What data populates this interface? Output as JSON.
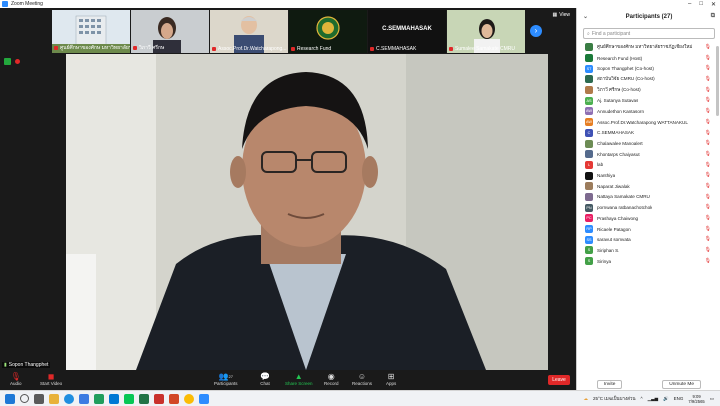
{
  "window": {
    "title": "Zoom Meeting"
  },
  "strip": {
    "view_label": "View",
    "thumbs": [
      {
        "name": "ศูนย์ศึกษาของศักษ มหาวิทยาลัยราช..."
      },
      {
        "name": "วิภาวี ศรีกษ"
      },
      {
        "name": "Assoc.Prof.Dr.Watcharapong..."
      },
      {
        "name": "Research Fund"
      },
      {
        "name": "C.SEMMAHASAK",
        "center_text": "C.SEMMAHASAK"
      },
      {
        "name": "Sumalee Samakate CMRU"
      }
    ]
  },
  "speaker": {
    "name": "Sopon Thangphet"
  },
  "toolbar": {
    "audio": "Audio",
    "video": "Start Video",
    "participants": "Participants",
    "participants_count": "27",
    "chat": "Chat",
    "share": "Share Screen",
    "record": "Record",
    "reactions": "Reactions",
    "apps": "Apps",
    "end": "Leave"
  },
  "panel": {
    "title": "Participants (27)",
    "search_placeholder": "Find a participant",
    "invite": "Invite",
    "unmute_me": "Unmute Me",
    "participants": [
      {
        "initials": "",
        "color": "#3a7d44",
        "name": "ศูนย์ศึกษาของศักษ มหาวิทยาลัยราชภัฏเชียงใหม่ (Me)"
      },
      {
        "initials": "",
        "color": "#1b7a3a",
        "name": "Research Fund (Host)"
      },
      {
        "initials": "ST",
        "color": "#2d8cff",
        "name": "Sopon Thangphet (Co-host)"
      },
      {
        "initials": "",
        "color": "#2d6a4f",
        "name": "สถาบันวิจัย CMRU (Co-host)"
      },
      {
        "initials": "",
        "color": "#b07a4a",
        "name": "วิภาวี ศรีกษ (Co-host)"
      },
      {
        "initials": "AS",
        "color": "#4caf50",
        "name": "Aj. Sutanya Sutavas"
      },
      {
        "initials": "AW",
        "color": "#8e6fb3",
        "name": "Annudethon Kantasorn"
      },
      {
        "initials": "AW",
        "color": "#e67e22",
        "name": "Assoc.Prof.Dr.Watcharapong WATTANAKUL"
      },
      {
        "initials": "C",
        "color": "#3f51b5",
        "name": "C.SEMMAHASAK"
      },
      {
        "initials": "",
        "color": "#6d8c55",
        "name": "Chalawalee Manoalert"
      },
      {
        "initials": "",
        "color": "#556b8d",
        "name": "Khontarps Chaiyasut"
      },
      {
        "initials": "L",
        "color": "#e53935",
        "name": "lab"
      },
      {
        "initials": "",
        "color": "#111111",
        "name": "Nanthiya"
      },
      {
        "initials": "",
        "color": "#9c7c5c",
        "name": "Naparat Jiwalak"
      },
      {
        "initials": "",
        "color": "#7d6a8f",
        "name": "Nattaya Samakate CMRU"
      },
      {
        "initials": "PN",
        "color": "#455a64",
        "name": "pornwana ratbanachotchok"
      },
      {
        "initials": "PC",
        "color": "#e91e63",
        "name": "Prashaya Chaiwong"
      },
      {
        "initials": "RP",
        "color": "#2d8cff",
        "name": "Ricaele Patagon"
      },
      {
        "initials": "SS",
        "color": "#2d8cff",
        "name": "saravut somvata"
      },
      {
        "initials": "S",
        "color": "#43a047",
        "name": "Siriphan S."
      },
      {
        "initials": "S",
        "color": "#43a047",
        "name": "Sirinya"
      }
    ]
  },
  "taskbar": {
    "search_label": "พิมพ์ที่นี่เพื่อค้นหา",
    "weather": "25°C เมฆเป็นบางส่วน",
    "lang": "ENG",
    "time": "9:09",
    "date": "7/9/2565"
  }
}
